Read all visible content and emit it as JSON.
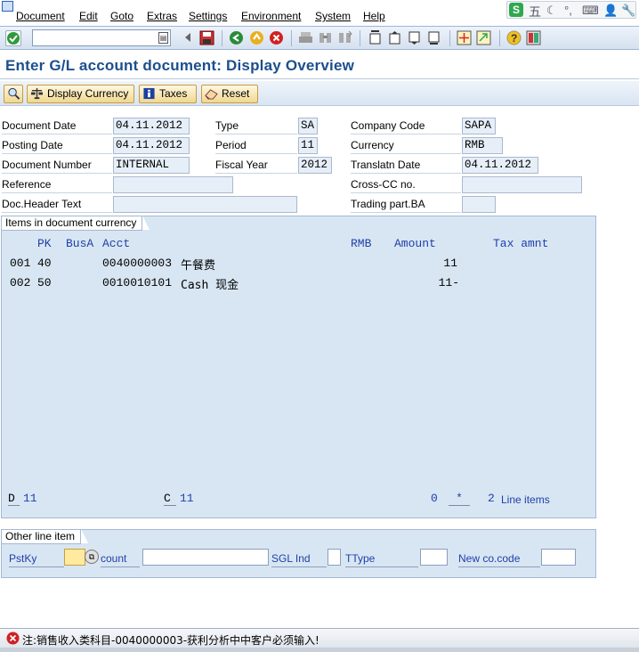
{
  "menu": {
    "items": [
      "Document",
      "Edit",
      "Goto",
      "Extras",
      "Settings",
      "Environment",
      "System",
      "Help"
    ]
  },
  "ime": {
    "glyph_s": "S",
    "glyph_wu": "五"
  },
  "toolbar": {
    "command_value": ""
  },
  "page": {
    "title": "Enter G/L account document: Display Overview"
  },
  "app_toolbar": {
    "display_currency": "Display Currency",
    "taxes": "Taxes",
    "reset": "Reset"
  },
  "header": {
    "document_date_label": "Document Date",
    "document_date": "04.11.2012",
    "type_label": "Type",
    "type": "SA",
    "company_code_label": "Company Code",
    "company_code": "SAPA",
    "posting_date_label": "Posting Date",
    "posting_date": "04.11.2012",
    "period_label": "Period",
    "period": "11",
    "currency_label": "Currency",
    "currency": "RMB",
    "document_number_label": "Document Number",
    "document_number": "INTERNAL",
    "fiscal_year_label": "Fiscal Year",
    "fiscal_year": "2012",
    "translatn_date_label": "Translatn Date",
    "translatn_date": "04.11.2012",
    "reference_label": "Reference",
    "reference": "",
    "cross_cc_label": "Cross-CC no.",
    "cross_cc": "",
    "doc_header_text_label": "Doc.Header Text",
    "doc_header_text": "",
    "trading_part_label": "Trading part.BA",
    "trading_part": ""
  },
  "items_group": {
    "title": "Items in document currency",
    "columns": {
      "pk": "PK",
      "busa": "BusA",
      "acct": "Acct",
      "currency": "RMB",
      "amount": "Amount",
      "tax": "Tax amnt"
    },
    "rows": [
      {
        "line": "001",
        "pk": "40",
        "acct": "0040000003",
        "text": "午餐费",
        "amount": "11"
      },
      {
        "line": "002",
        "pk": "50",
        "acct": "0010010101",
        "text": "Cash 现金",
        "amount": "11-"
      }
    ],
    "footer": {
      "d_label": "D",
      "d_value": "11",
      "c_label": "C",
      "c_value": "11",
      "balance": "0",
      "star": "*",
      "line_count": "2",
      "line_items_label": "Line items"
    }
  },
  "other_group": {
    "title": "Other line item",
    "pstky_label": "PstKy",
    "account_label": "count",
    "sgl_label": "SGL Ind",
    "ttype_label": "TType",
    "new_cocode_label": "New co.code"
  },
  "status": {
    "message": "注:销售收入类科目-0040000003-获利分析中中客户必须输入!"
  },
  "colors": {
    "title_blue": "#1c4f8e",
    "group_bg": "#d8e6f3",
    "field_bg": "#e6eef8",
    "button_gold": "#f0d890",
    "error_red": "#d22020"
  }
}
